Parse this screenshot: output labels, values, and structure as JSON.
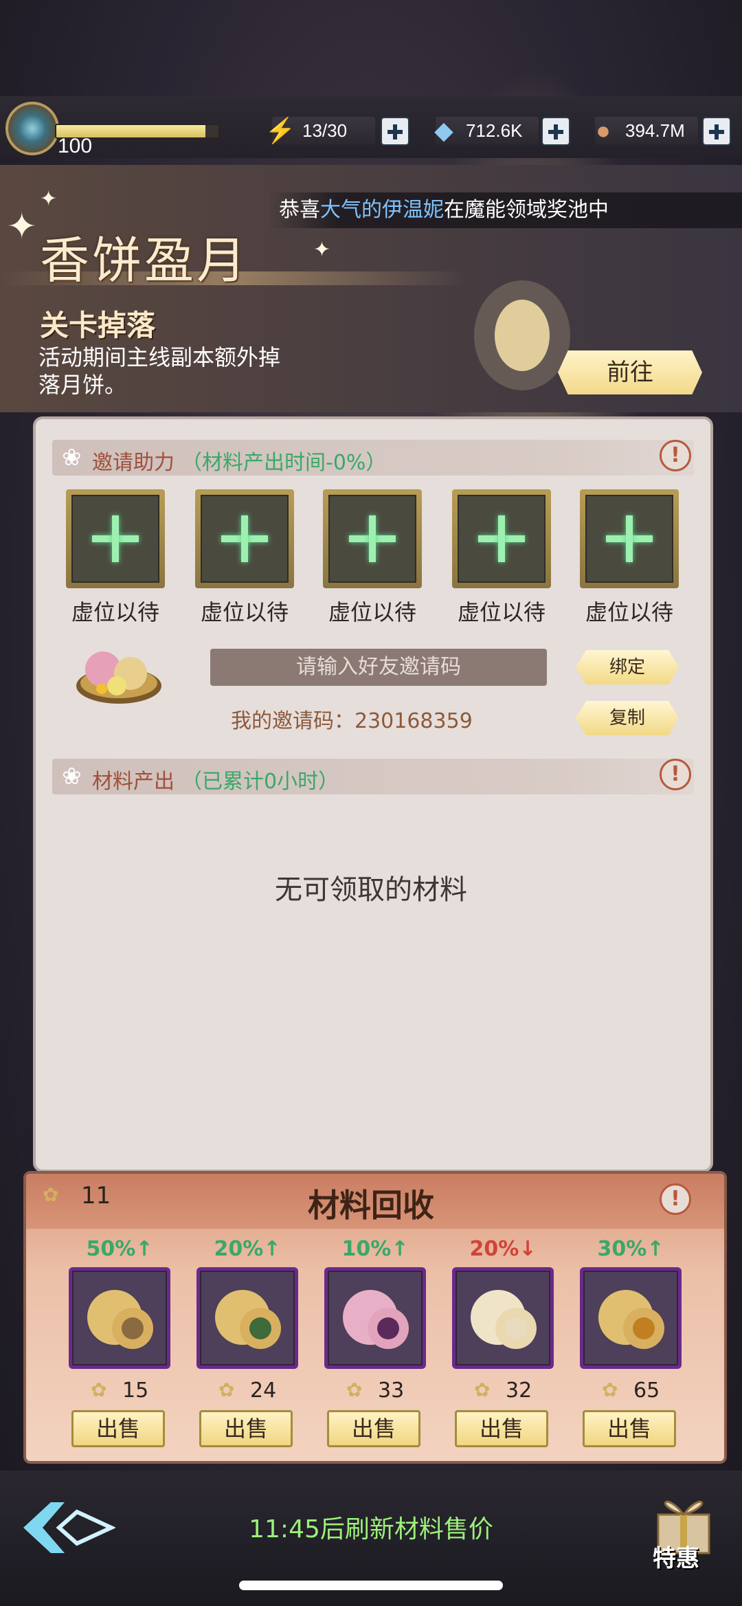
{
  "hud": {
    "level": "100",
    "exp_fraction": 0.92,
    "stamina": "13/30",
    "gems": "712.6K",
    "gold": "394.7M"
  },
  "marquee": {
    "prefix": "恭喜",
    "highlight": "大气的伊温妮",
    "suffix": "在魔能领域奖池中"
  },
  "event": {
    "title": "香饼盈月",
    "drop_title": "关卡掉落",
    "drop_desc": "活动期间主线副本额外掉落月饼。",
    "go_label": "前往"
  },
  "invite": {
    "header": "邀请助力",
    "header_sub": "（材料产出时间-0%）",
    "slot_label": "虚位以待",
    "slots": [
      "虚位以待",
      "虚位以待",
      "虚位以待",
      "虚位以待",
      "虚位以待"
    ],
    "input_placeholder": "请输入好友邀请码",
    "bind_label": "绑定",
    "copy_label": "复制",
    "my_code_label": "我的邀请码：",
    "my_code": "230168359"
  },
  "output": {
    "header": "材料产出",
    "header_sub": "（已累计0小时）",
    "empty": "无可领取的材料"
  },
  "recycle": {
    "title": "材料回收",
    "token_count": "11",
    "sell_label": "出售",
    "items": [
      {
        "pct": "50%↑",
        "trend": "up",
        "price": "15",
        "filling": "#8a6a40"
      },
      {
        "pct": "20%↑",
        "trend": "up",
        "price": "24",
        "filling": "#3f6a3a"
      },
      {
        "pct": "10%↑",
        "trend": "up",
        "price": "33",
        "filling": "#5a2a5a"
      },
      {
        "pct": "20%↓",
        "trend": "down",
        "price": "32",
        "filling": "#e8dcc0"
      },
      {
        "pct": "30%↑",
        "trend": "up",
        "price": "65",
        "filling": "#c08020"
      }
    ]
  },
  "footer": {
    "refresh_text": "11:45后刷新材料售价",
    "gift_label": "特惠"
  },
  "colors": {
    "accent_green": "#3aa868",
    "down_red": "#d04438",
    "button_gold": "#f2d986"
  }
}
